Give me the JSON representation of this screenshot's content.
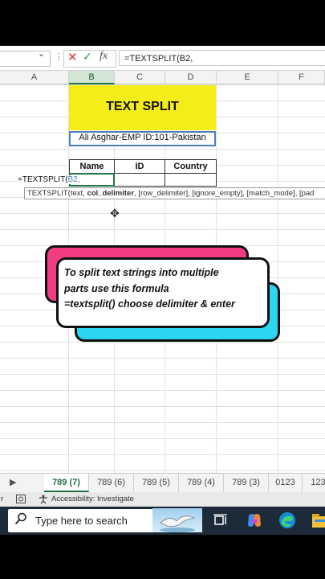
{
  "formula_bar": {
    "name_box_dropdown": "⌄",
    "dots": "⋮",
    "cancel_label": "✕",
    "enter_label": "✓",
    "fx_label": "fx",
    "formula_text": "=TEXTSPLIT(B2,"
  },
  "columns": [
    "A",
    "B",
    "C",
    "D",
    "E",
    "F"
  ],
  "sheet": {
    "title": "TEXT SPLIT",
    "employee_text": "Ali Asghar-EMP ID:101-Pakistan",
    "table_headers": [
      "Name",
      "ID",
      "Country"
    ],
    "editing_formula_prefix": "=TEXTSPLIT(",
    "editing_formula_ref": "B2,",
    "tooltip": {
      "fn": "TEXTSPLIT(text, ",
      "bold_arg": "col_delimiter",
      "rest": ", [row_delimiter], [ignore_empty], [match_mode], [pad"
    },
    "cursor_glyph": "✥"
  },
  "callout": {
    "lines": [
      "To split text strings into multiple",
      "parts use this formula",
      "=textsplit() choose delimiter & enter"
    ]
  },
  "tabs": {
    "nav_glyph": "▶",
    "items": [
      "789 (7)",
      "789 (6)",
      "789 (5)",
      "789 (4)",
      "789 (3)",
      "0123",
      "123"
    ],
    "active_index": 0
  },
  "status_bar": {
    "left_fragment": "r",
    "accessibility": "Accessibility: Investigate"
  },
  "taskbar": {
    "search_placeholder": "Type here to search"
  },
  "colors": {
    "title_fill": "#f5ed18",
    "excel_green": "#217346",
    "callout_pink": "#ef3c83",
    "callout_cyan": "#2bd5f0",
    "taskbar": "#1d2a38"
  }
}
